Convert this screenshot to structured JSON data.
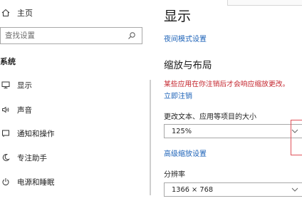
{
  "sidebar": {
    "home_label": "主页",
    "search_placeholder": "查找设置",
    "section_title": "系统",
    "items": [
      {
        "label": "显示",
        "icon": "monitor-icon"
      },
      {
        "label": "声音",
        "icon": "speaker-icon"
      },
      {
        "label": "通知和操作",
        "icon": "notification-icon"
      },
      {
        "label": "专注助手",
        "icon": "moon-icon"
      },
      {
        "label": "电源和睡眠",
        "icon": "power-icon"
      }
    ]
  },
  "main": {
    "title": "显示",
    "night_mode_link": "夜间模式设置",
    "scale_layout_heading": "缩放与布局",
    "warning_text": "某些应用在你注销后才会响应缩放更改。",
    "logout_link": "立即注销",
    "scale_label": "更改文本、应用等项目的大小",
    "scale_value": "125%",
    "advanced_scale_link": "高级缩放设置",
    "resolution_label": "分辨率",
    "resolution_value": "1366 × 768"
  },
  "colors": {
    "link": "#1e63b8",
    "warning": "#c4262e",
    "highlight": "#e0525a"
  }
}
